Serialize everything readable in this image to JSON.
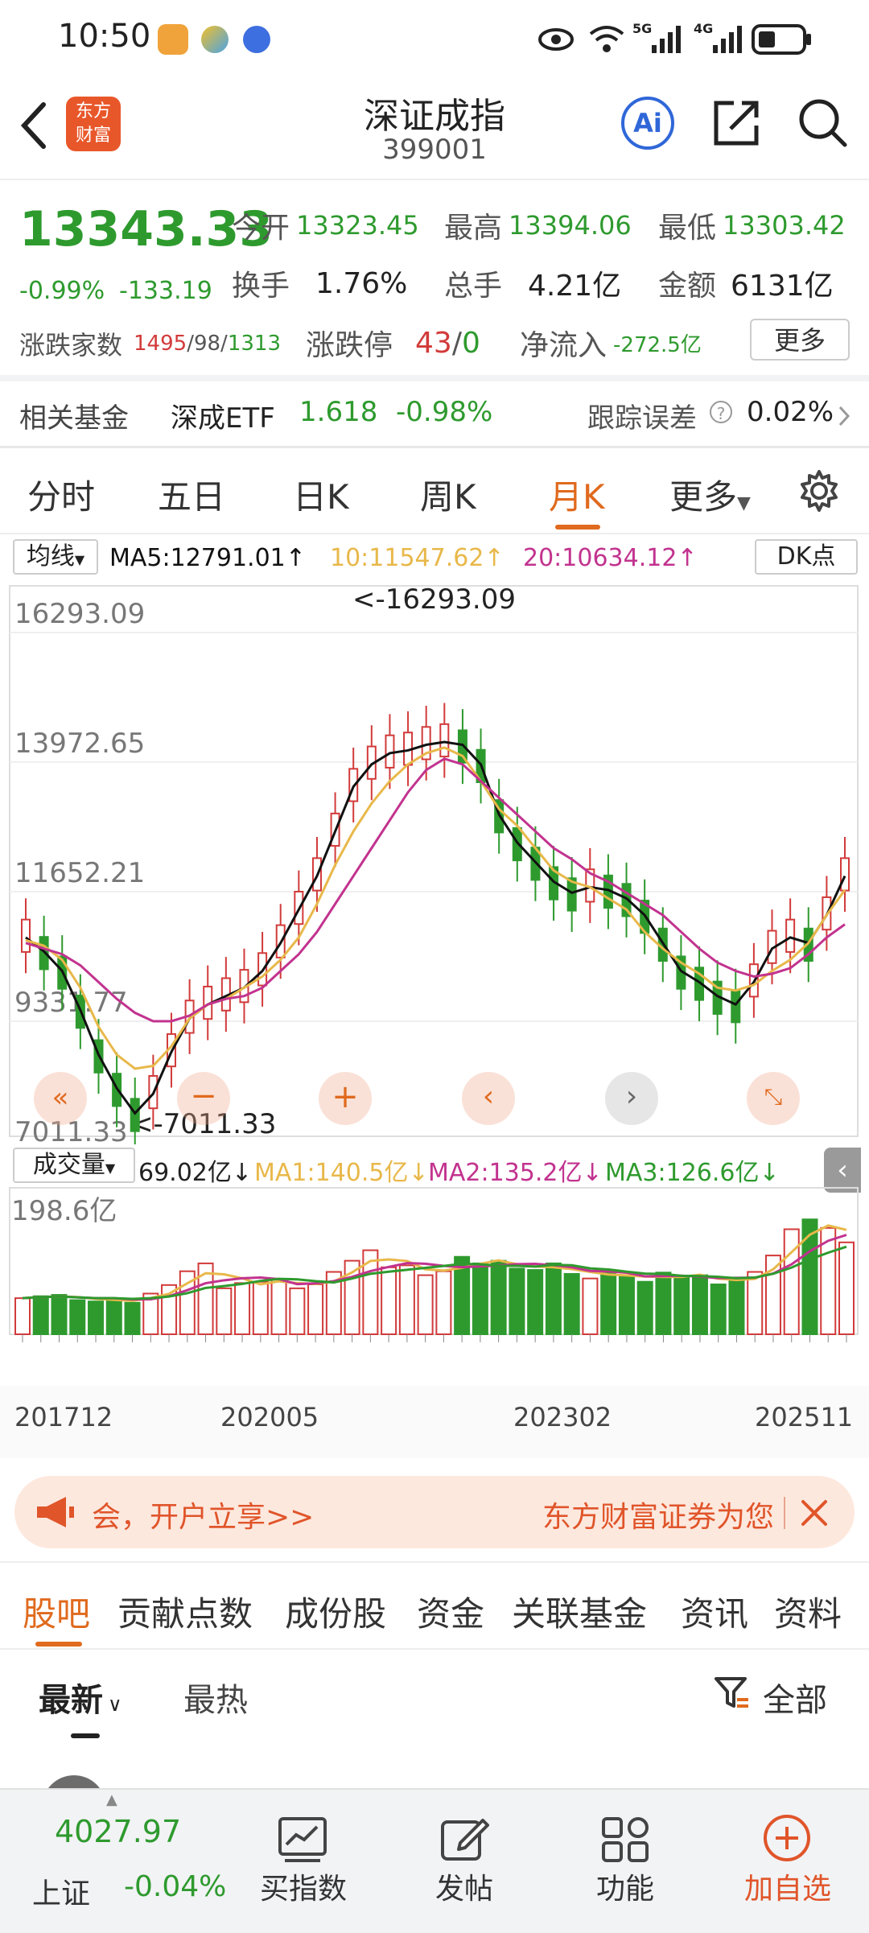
{
  "status_bar": {
    "time": "10:50",
    "net1": "5G",
    "net2": "4G"
  },
  "header": {
    "title": "深证成指",
    "code": "399001",
    "logo_text": "东方财富",
    "ai_label": "Ai"
  },
  "quote": {
    "price": "13343.33",
    "change_pct": "-0.99%",
    "change": "-133.19",
    "open_label": "今开",
    "open": "13323.45",
    "high_label": "最高",
    "high": "13394.06",
    "low_label": "最低",
    "low": "13303.42",
    "turnover_label": "换手",
    "turnover": "1.76%",
    "volume_label": "总手",
    "volume": "4.21亿",
    "amount_label": "金额",
    "amount": "6131亿",
    "breadth_label": "涨跌家数",
    "up": "1495",
    "flat": "98",
    "down": "1313",
    "limit_label": "涨跌停",
    "limit_up": "43",
    "limit_down": "0",
    "inflow_label": "净流入",
    "inflow": "-272.5亿",
    "more_label": "更多"
  },
  "fund": {
    "label": "相关基金",
    "name": "深成ETF",
    "price": "1.618",
    "change": "-0.98%",
    "track_label": "跟踪误差",
    "track_value": "0.02%"
  },
  "period_tabs": [
    {
      "label": "分时",
      "active": false
    },
    {
      "label": "五日",
      "active": false
    },
    {
      "label": "日K",
      "active": false
    },
    {
      "label": "周K",
      "active": false
    },
    {
      "label": "月K",
      "active": true
    },
    {
      "label": "更多",
      "active": false
    }
  ],
  "ma_bar": {
    "selector": "均线",
    "ma5": "MA5:12791.01",
    "ma10": "10:11547.62",
    "ma20": "20:10634.12",
    "dk": "DK点"
  },
  "colors": {
    "up": "#d23a3a",
    "down": "#2e9a2e",
    "ma5": "#111111",
    "ma10": "#e8b84a",
    "ma20": "#c2338f",
    "accent": "#e06a1e",
    "blue": "#2f67d8"
  },
  "chart_data": {
    "type": "candlestick",
    "y_ticks": [
      "16293.09",
      "13972.65",
      "11652.21",
      "9331.77",
      "7011.33"
    ],
    "ylim": [
      7011.33,
      16293.09
    ],
    "max_label": "<-16293.09",
    "min_label": "<-7011.33",
    "x_ticks": [
      "201712",
      "202005",
      "202302",
      "202511"
    ],
    "ma_series": [
      {
        "name": "MA5",
        "values": [
          10400,
          10150,
          9800,
          9100,
          8300,
          7700,
          7250,
          7600,
          8350,
          8950,
          9200,
          9350,
          9500,
          9800,
          10300,
          10900,
          11500,
          12300,
          13100,
          13500,
          13700,
          13750,
          13850,
          13900,
          13850,
          13500,
          12600,
          12100,
          11750,
          11400,
          11200,
          11300,
          11250,
          11100,
          10800,
          10300,
          9800,
          9600,
          9350,
          9200,
          9600,
          10200,
          10400,
          10300,
          10800,
          11500
        ]
      },
      {
        "name": "MA10",
        "values": [
          10350,
          10250,
          10000,
          9500,
          8800,
          8300,
          8050,
          8100,
          8450,
          8950,
          9200,
          9300,
          9500,
          9700,
          10000,
          10400,
          11000,
          11700,
          12300,
          12800,
          13200,
          13500,
          13700,
          13800,
          13650,
          13200,
          12700,
          12400,
          12000,
          11600,
          11400,
          11300,
          11100,
          10900,
          10500,
          10200,
          9950,
          9750,
          9500,
          9450,
          9550,
          9800,
          10000,
          10300,
          10800,
          11250
        ]
      },
      {
        "name": "MA20",
        "values": [
          10300,
          10200,
          10100,
          9900,
          9600,
          9300,
          9050,
          8900,
          8900,
          9000,
          9200,
          9300,
          9350,
          9500,
          9800,
          10100,
          10500,
          11000,
          11500,
          12000,
          12500,
          13000,
          13400,
          13600,
          13500,
          13200,
          12900,
          12600,
          12300,
          12000,
          11800,
          11550,
          11400,
          11200,
          11000,
          10800,
          10500,
          10200,
          9950,
          9800,
          9700,
          9750,
          9850,
          10100,
          10400,
          10634
        ]
      }
    ],
    "volume": {
      "label": "成交量",
      "last": "69.02亿",
      "ma1": "MA1:140.5亿",
      "ma2": "MA2:135.2亿",
      "ma3": "MA3:126.6亿",
      "max_tick": "198.6亿",
      "values": [
        55,
        58,
        60,
        52,
        50,
        55,
        48,
        62,
        75,
        96,
        108,
        70,
        78,
        80,
        84,
        70,
        76,
        95,
        112,
        128,
        102,
        105,
        90,
        96,
        118,
        108,
        112,
        100,
        98,
        108,
        92,
        85,
        96,
        88,
        80,
        94,
        88,
        90,
        76,
        82,
        95,
        120,
        160,
        175,
        162,
        140
      ]
    }
  },
  "banner": {
    "text_left": "会，开户立享>>",
    "text_right": "东方财富证券为您"
  },
  "section_tabs": [
    {
      "label": "股吧",
      "active": true
    },
    {
      "label": "贡献点数",
      "active": false
    },
    {
      "label": "成份股",
      "active": false
    },
    {
      "label": "资金",
      "active": false
    },
    {
      "label": "关联基金",
      "active": false
    },
    {
      "label": "资讯",
      "active": false
    },
    {
      "label": "资料",
      "active": false
    }
  ],
  "sort_tabs": {
    "latest": "最新",
    "hot": "最热",
    "filter": "全部"
  },
  "bottom_bar": {
    "index_value": "4027.97",
    "index_name": "上证",
    "index_change": "-0.04%",
    "buy_index": "买指数",
    "post": "发帖",
    "functions": "功能",
    "add_watch": "加自选"
  }
}
